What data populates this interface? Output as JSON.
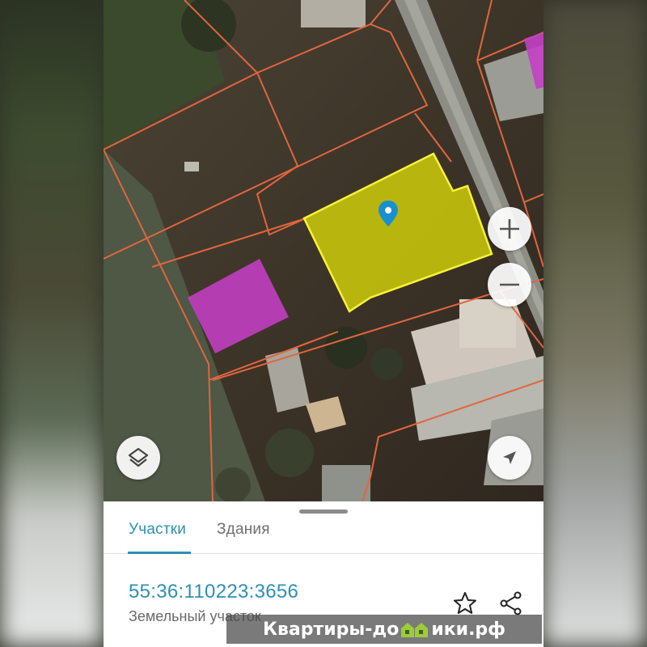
{
  "map": {
    "colors": {
      "selected_parcel": "#d4d20a",
      "other_parcel": "#c43fc4",
      "boundary": "#e0663e",
      "pin": "#1a8fd0"
    },
    "icons": {
      "zoom_in": "plus-icon",
      "zoom_out": "minus-icon",
      "layers": "layers-icon",
      "locate": "navigation-arrow-icon",
      "pin": "location-pin-icon"
    }
  },
  "sheet": {
    "tabs": [
      {
        "label": "Участки",
        "active": true
      },
      {
        "label": "Здания",
        "active": false
      }
    ],
    "parcel": {
      "cadastral_number": "55:36:110223:3656",
      "type": "Земельный участок"
    },
    "actions": {
      "favorite_icon": "star-outline-icon",
      "share_icon": "share-icon"
    }
  },
  "watermark": {
    "text_before": "Квартиры-до",
    "text_after": "ики.рф"
  }
}
